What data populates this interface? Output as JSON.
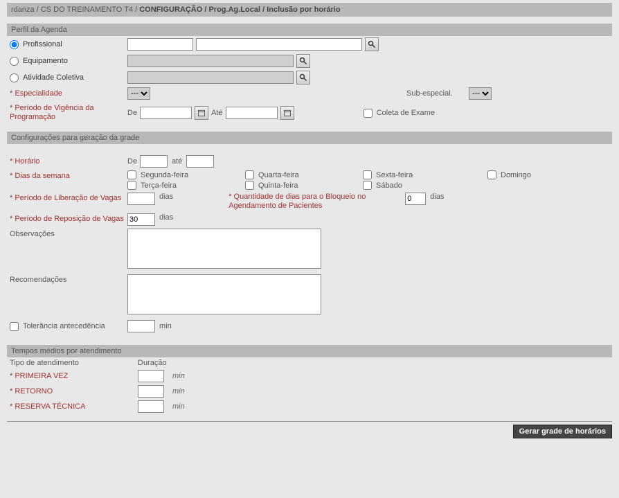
{
  "breadcrumb": {
    "p1": "rdanza / CS DO TREINAMENTO T4 /",
    "p2": "CONFIGURAÇÃO",
    "p3": " / Prog.Ag.Local / Inclusão por horário"
  },
  "section1": {
    "title": "Perfil da Agenda",
    "radio_profissional": "Profissional",
    "radio_equipamento": "Equipamento",
    "radio_atividade": "Atividade Coletiva",
    "especialidade_label": "Especialidade",
    "especialidade_value": "---",
    "subespecial_label": "Sub-especial.",
    "subespecial_value": "---",
    "periodo_vig_label": "Período de Vigência da Programação",
    "de_label": "De",
    "ate_label": "Até",
    "coleta_label": "Coleta de Exame"
  },
  "section2": {
    "title": "Configurações para geração da grade",
    "horario_label": "Horário",
    "horario_de": "De",
    "horario_ate": "até",
    "dias_label": "Dias da semana",
    "seg": "Segunda-feira",
    "ter": "Terça-feira",
    "qua": "Quarta-feira",
    "qui": "Quinta-feira",
    "sex": "Sexta-feira",
    "sab": "Sábado",
    "dom": "Domingo",
    "periodo_lib_label": "Período de Liberação de Vagas",
    "dias_unit": "dias",
    "qtd_bloqueio_label": "Quantidade de dias para o Bloqueio no Agendamento de Pacientes",
    "qtd_bloqueio_value": "0",
    "periodo_rep_label": "Período de Reposição de Vagas",
    "periodo_rep_value": "30",
    "obs_label": "Observações",
    "recom_label": "Recomendações",
    "tolerancia_label": "Tolerância antecedência",
    "min_unit": "min"
  },
  "section3": {
    "title": "Tempos médios por atendimento",
    "col_tipo": "Tipo de atendimento",
    "col_duracao": "Duração",
    "primeira": "PRIMEIRA VEZ",
    "retorno": "RETORNO",
    "reserva": "RESERVA TÉCNICA",
    "min": "min"
  },
  "footer": {
    "gerar": "Gerar grade de horários"
  }
}
